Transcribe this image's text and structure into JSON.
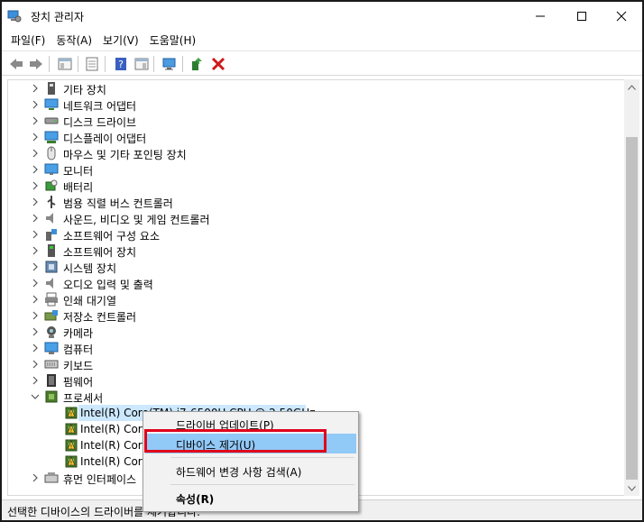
{
  "window": {
    "title": "장치 관리자"
  },
  "menu": [
    "파일(F)",
    "동작(A)",
    "보기(V)",
    "도움말(H)"
  ],
  "toolbar": {
    "buttons": [
      "back-icon",
      "forward-icon",
      "show-hide-tree-icon",
      "properties-icon",
      "help-icon",
      "action-pane-icon",
      "scan-hardware-icon",
      "update-driver-icon",
      "uninstall-icon"
    ]
  },
  "tree": {
    "items": [
      {
        "label": "기타 장치",
        "icon": "other-devices-icon",
        "expanded": false
      },
      {
        "label": "네트워크 어댑터",
        "icon": "network-adapter-icon",
        "expanded": false
      },
      {
        "label": "디스크 드라이브",
        "icon": "disk-drive-icon",
        "expanded": false
      },
      {
        "label": "디스플레이 어댑터",
        "icon": "display-adapter-icon",
        "expanded": false
      },
      {
        "label": "마우스 및 기타 포인팅 장치",
        "icon": "mouse-icon",
        "expanded": false
      },
      {
        "label": "모니터",
        "icon": "monitor-icon",
        "expanded": false
      },
      {
        "label": "배터리",
        "icon": "battery-icon",
        "expanded": false
      },
      {
        "label": "범용 직렬 버스 컨트롤러",
        "icon": "usb-icon",
        "expanded": false
      },
      {
        "label": "사운드, 비디오 및 게임 컨트롤러",
        "icon": "sound-icon",
        "expanded": false
      },
      {
        "label": "소프트웨어 구성 요소",
        "icon": "software-component-icon",
        "expanded": false
      },
      {
        "label": "소프트웨어 장치",
        "icon": "software-device-icon",
        "expanded": false
      },
      {
        "label": "시스템 장치",
        "icon": "system-device-icon",
        "expanded": false
      },
      {
        "label": "오디오 입력 및 출력",
        "icon": "audio-io-icon",
        "expanded": false
      },
      {
        "label": "인쇄 대기열",
        "icon": "print-queue-icon",
        "expanded": false
      },
      {
        "label": "저장소 컨트롤러",
        "icon": "storage-controller-icon",
        "expanded": false
      },
      {
        "label": "카메라",
        "icon": "camera-icon",
        "expanded": false
      },
      {
        "label": "컴퓨터",
        "icon": "computer-icon",
        "expanded": false
      },
      {
        "label": "키보드",
        "icon": "keyboard-icon",
        "expanded": false
      },
      {
        "label": "펌웨어",
        "icon": "firmware-icon",
        "expanded": false
      },
      {
        "label": "프로세서",
        "icon": "processor-icon",
        "expanded": true
      }
    ],
    "processors": [
      "Intel(R) Core(TM) i7-6500U CPU @ 2.50GHz",
      "Intel(R) Core(",
      "Intel(R) Core(",
      "Intel(R) Core("
    ],
    "last_item": {
      "label": "휴먼 인터페이스",
      "icon": "hid-icon"
    }
  },
  "context_menu": {
    "items": [
      {
        "label": "드라이버 업데이트(P)",
        "bold": false
      },
      {
        "label": "디바이스 제거(U)",
        "bold": false,
        "highlighted": true
      },
      {
        "label": "하드웨어 변경 사항 검색(A)",
        "bold": false
      },
      {
        "label": "속성(R)",
        "bold": true
      }
    ]
  },
  "status": {
    "text": "선택한 디바이스의 드라이버를 제거합니다."
  },
  "colors": {
    "selection": "#cce8ff",
    "menu_highlight": "#91c9f7",
    "annotation_red": "#e0001b"
  }
}
